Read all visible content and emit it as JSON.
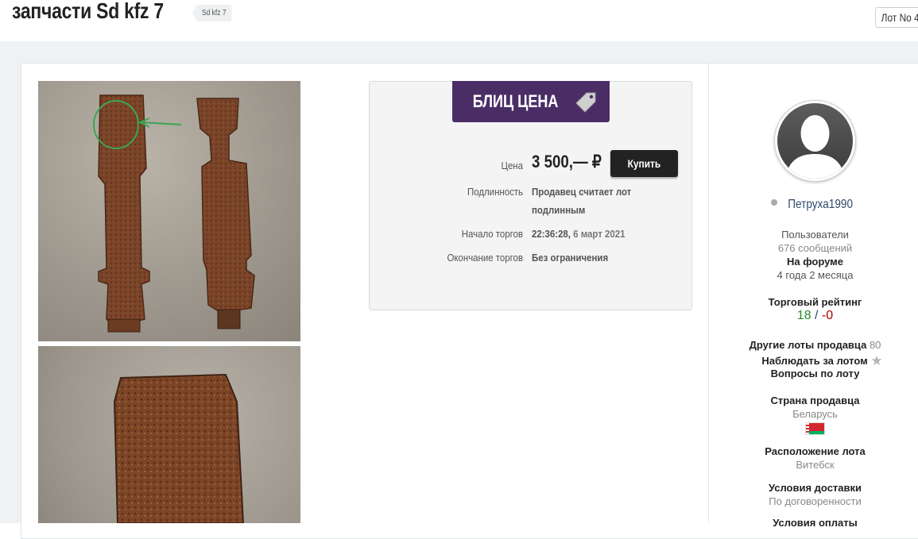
{
  "header": {
    "title": "запчасти Sd kfz 7",
    "tag": "Sd kfz 7",
    "lot_chip": "Лот No 4"
  },
  "blitz": {
    "banner": "БЛИЦ ЦЕНА",
    "price_label": "Цена",
    "price_value": "3 500,— ₽",
    "buy_button": "Купить",
    "authenticity_label": "Подлинность",
    "authenticity_value_1": "Продавец считает лот",
    "authenticity_value_2": "подлинным",
    "start_label": "Начало торгов",
    "start_time": "22:36:28,",
    "start_date": "6 март 2021",
    "end_label": "Окончание торгов",
    "end_value": "Без ограничения"
  },
  "seller": {
    "username": "Петруха1990",
    "group": "Пользователи",
    "messages": "676 сообщений",
    "on_forum_label": "На форуме",
    "on_forum_value": "4 года 2 месяца",
    "rating_label": "Торговый рейтинг",
    "rating_positive": "18",
    "rating_sep": "/",
    "rating_negative": "-0",
    "other_lots_label": "Другие лоты продавца",
    "other_lots_count": "80",
    "watch_label": "Наблюдать за лотом",
    "questions_label": "Вопросы по лоту",
    "country_label": "Страна продавца",
    "country_value": "Беларусь",
    "location_label": "Расположение лота",
    "location_value": "Витебск",
    "delivery_label": "Условия доставки",
    "delivery_value": "По договоренности",
    "payment_label": "Условия оплаты"
  },
  "colors": {
    "banner": "#4b2d66",
    "rating_positive": "#2a8a2a",
    "rating_negative": "#aa0000",
    "username": "#2e4a6b"
  },
  "icons": {
    "banner": "price-tag-icon",
    "watch": "star-icon",
    "status": "offline-dot-icon"
  }
}
